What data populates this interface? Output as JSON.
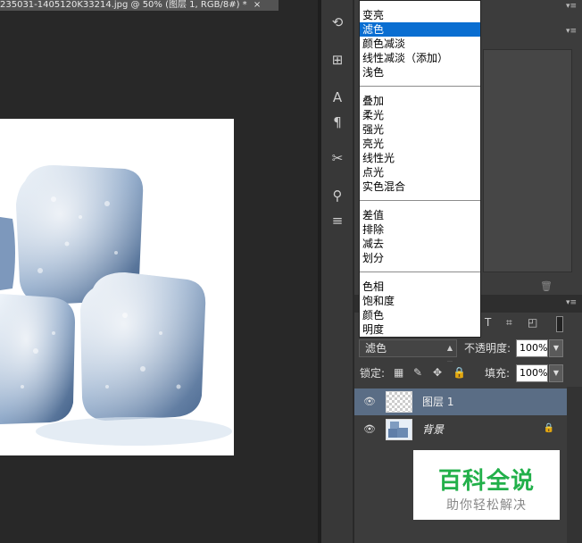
{
  "document": {
    "tab_title": "235031-1405120K33214.jpg @ 50% (图层 1, RGB/8#) *",
    "close_glyph": "×"
  },
  "blend_menu": {
    "groups": [
      [
        "变亮",
        "滤色",
        "颜色减淡",
        "线性减淡（添加）",
        "浅色"
      ],
      [
        "叠加",
        "柔光",
        "强光",
        "亮光",
        "线性光",
        "点光",
        "实色混合"
      ],
      [
        "差值",
        "排除",
        "减去",
        "划分"
      ],
      [
        "色相",
        "饱和度",
        "颜色",
        "明度"
      ]
    ],
    "selected": "滤色"
  },
  "layers_panel": {
    "blend_mode": "滤色",
    "opacity_label": "不透明度:",
    "opacity_value": "100%",
    "lock_label": "锁定:",
    "fill_label": "填充:",
    "fill_value": "100%",
    "layers": [
      {
        "name": "图层 1",
        "active": true,
        "locked": false
      },
      {
        "name": "背景",
        "active": false,
        "locked": true
      }
    ]
  },
  "watermark": {
    "title": "百科全说",
    "subtitle": "助你轻松解决"
  },
  "colors": {
    "selection": "#0a6ed1",
    "active_layer": "#5a6d85",
    "watermark_green": "#22b04a"
  }
}
